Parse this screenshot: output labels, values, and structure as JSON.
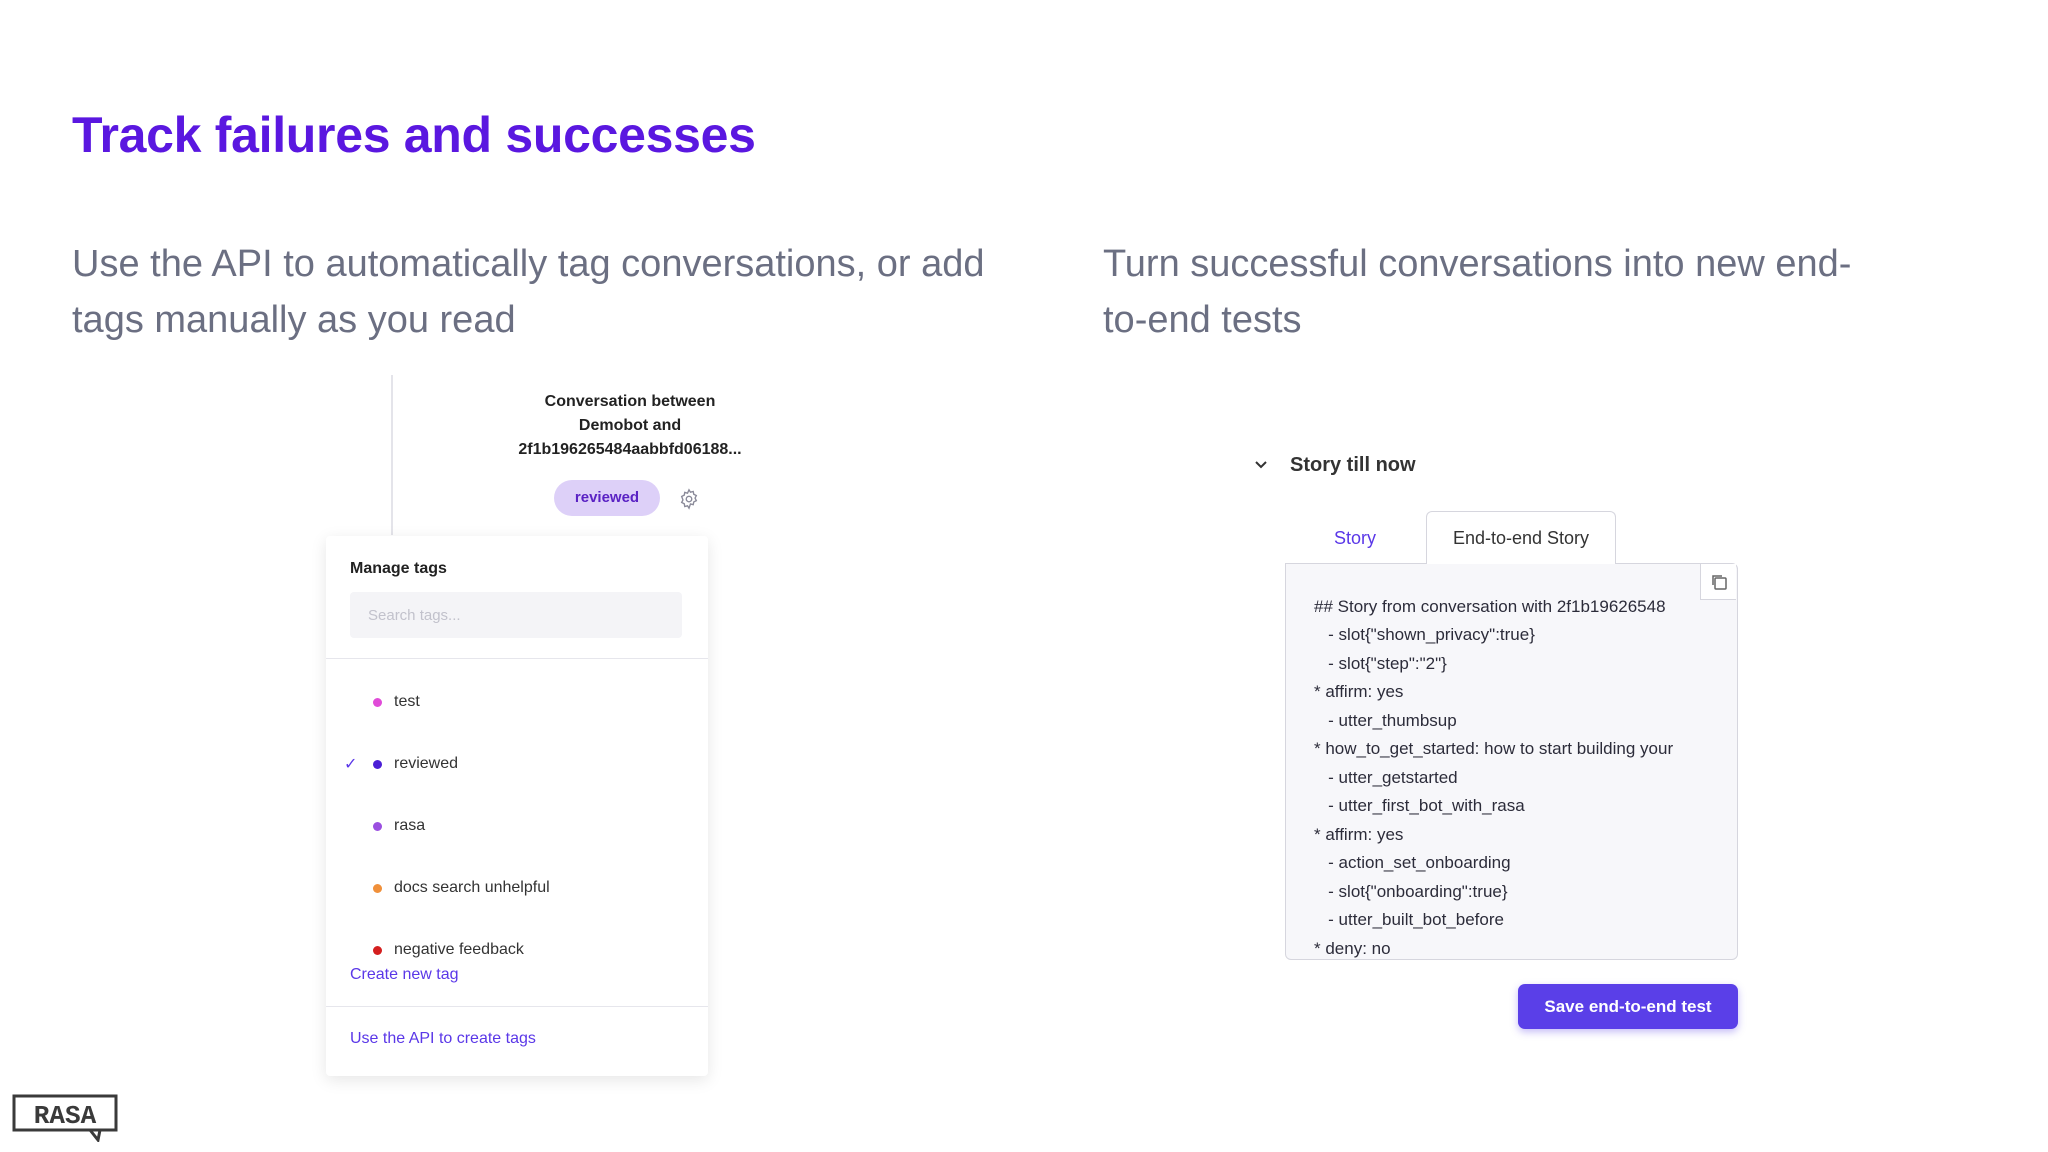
{
  "slide": {
    "title": "Track failures and successes",
    "left_subtitle": "Use the API to automatically tag conversations, or add tags manually as you read",
    "right_subtitle": "Turn successful conversations into new end-to-end tests"
  },
  "conversation": {
    "title_lines": [
      "Conversation between",
      "Demobot and",
      "2f1b196265484aabbfd06188..."
    ],
    "badge": "reviewed"
  },
  "manage_tags": {
    "heading": "Manage tags",
    "search_placeholder": "Search tags...",
    "tags": [
      {
        "label": "test",
        "color": "#e04bd8",
        "checked": false
      },
      {
        "label": "reviewed",
        "color": "#4b1fd6",
        "checked": true
      },
      {
        "label": "rasa",
        "color": "#9b4fe0",
        "checked": false
      },
      {
        "label": "docs search unhelpful",
        "color": "#f0903a",
        "checked": false
      },
      {
        "label": "negative feedback",
        "color": "#d41f1f",
        "checked": false
      }
    ],
    "check_glyph": "✓",
    "create_link": "Create new tag",
    "api_link": "Use the API to create tags"
  },
  "story": {
    "section_title": "Story till now",
    "tabs": [
      "Story",
      "End-to-end Story"
    ],
    "active_tab": "End-to-end Story",
    "lines": [
      "## Story from conversation with 2f1b19626548",
      "   - slot{\"shown_privacy\":true}",
      "   - slot{\"step\":\"2\"}",
      "* affirm: yes",
      "   - utter_thumbsup",
      "* how_to_get_started: how to start building your",
      "   - utter_getstarted",
      "   - utter_first_bot_with_rasa",
      "* affirm: yes",
      "   - action_set_onboarding",
      "   - slot{\"onboarding\":true}",
      "   - utter_built_bot_before",
      "* deny: no"
    ],
    "save_button": "Save end-to-end test"
  },
  "logo": {
    "text": "RASA",
    "icon": "rasa-logo-icon"
  },
  "colors": {
    "accent": "#5a17e0",
    "button": "#5a3fe8",
    "badge_bg": "#ddd0f8"
  }
}
